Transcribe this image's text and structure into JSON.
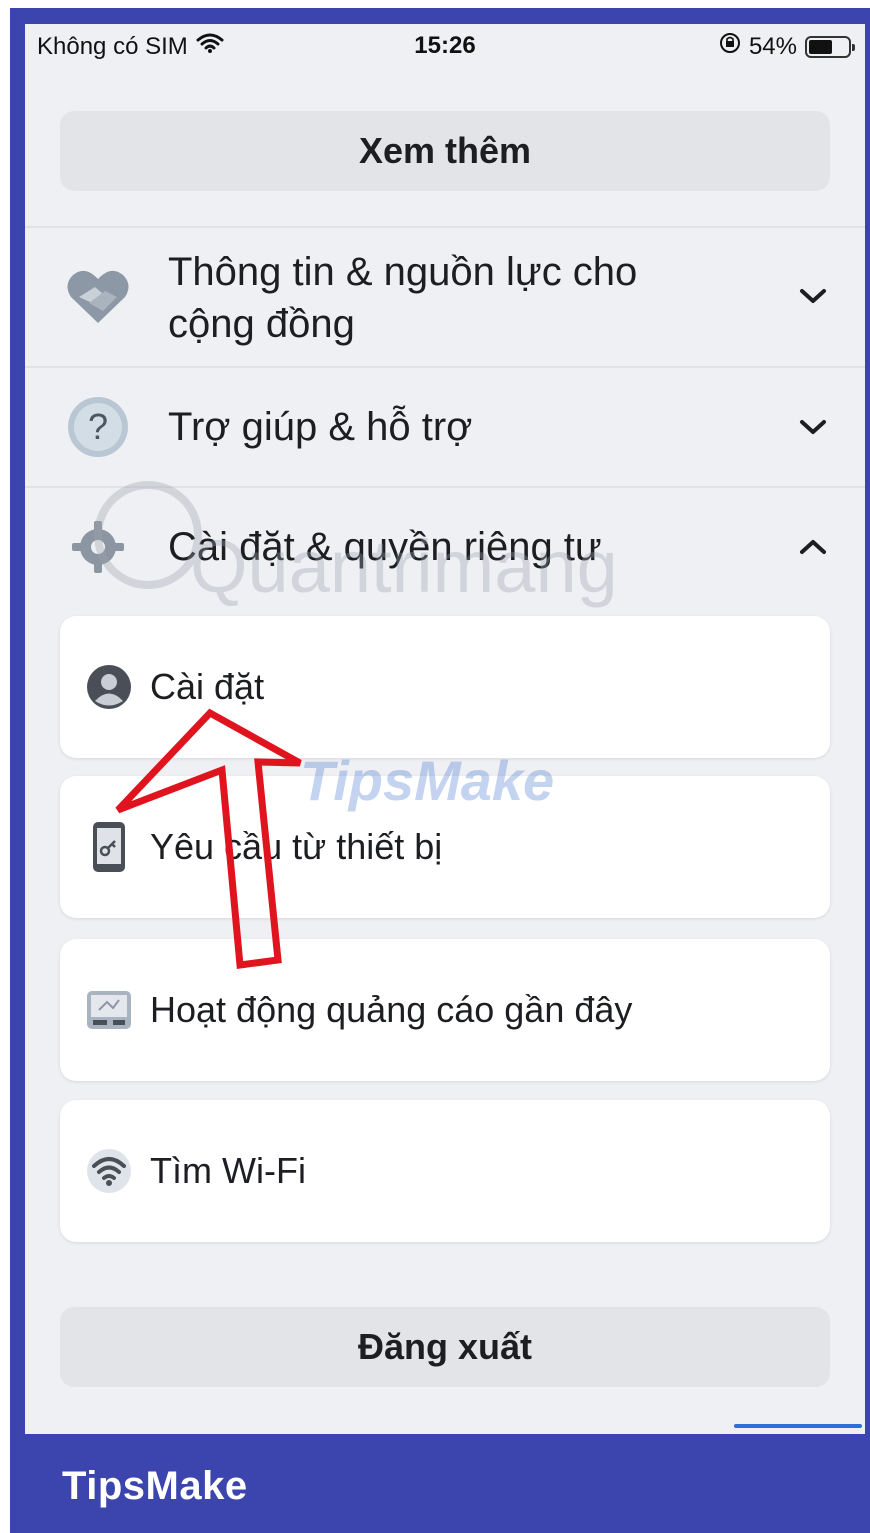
{
  "status_bar": {
    "carrier": "Không có SIM",
    "time": "15:26",
    "battery": "54%",
    "battery_level": 0.54
  },
  "buttons": {
    "see_more": "Xem thêm",
    "logout": "Đăng xuất"
  },
  "sections": [
    {
      "label_line1": "Thông tin & nguồn lực cho",
      "label_line2": "cộng đồng",
      "icon": "handshake-heart-icon",
      "expanded": false
    },
    {
      "label": "Trợ giúp & hỗ trợ",
      "icon": "help-question-icon",
      "expanded": false
    },
    {
      "label": "Cài đặt & quyền riêng tư",
      "icon": "gear-icon",
      "expanded": true
    }
  ],
  "settings_items": [
    {
      "label": "Cài đặt",
      "icon": "user-avatar-icon"
    },
    {
      "label": "Yêu cầu từ thiết bị",
      "icon": "phone-key-icon"
    },
    {
      "label": "Hoạt động quảng cáo gần đây",
      "icon": "ad-activity-icon"
    },
    {
      "label": "Tìm Wi-Fi",
      "icon": "wifi-icon"
    }
  ],
  "watermarks": {
    "tipsmake": "TipsMake",
    "quantrimang": "Quantrimang"
  },
  "footer": {
    "brand": "TipsMake"
  },
  "colors": {
    "frame": "#3b45ad",
    "screen_bg": "#eff0f3",
    "button_bg": "#e2e4e8",
    "arrow": "#e0141e"
  }
}
